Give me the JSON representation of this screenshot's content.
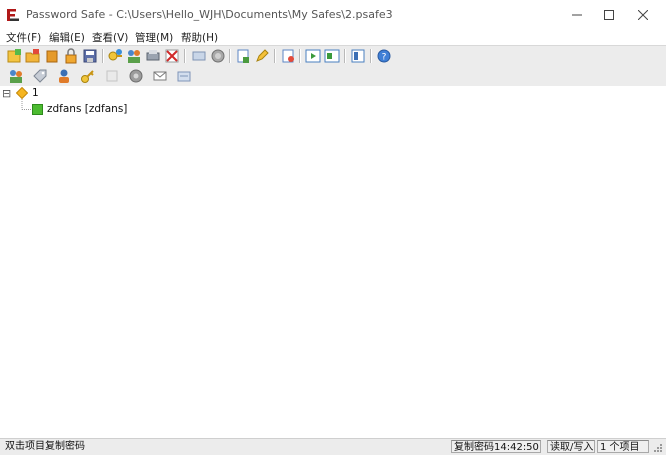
{
  "window": {
    "title": "Password Safe - C:\\Users\\Hello_WJH\\Documents\\My Safes\\2.psafe3",
    "app_icon": "password-safe-logo",
    "controls": [
      "minimize-icon",
      "maximize-icon",
      "close-icon"
    ]
  },
  "menu": [
    "文件(F)",
    "编辑(E)",
    "查看(V)",
    "管理(M)",
    "帮助(H)"
  ],
  "toolbar1": [
    "new-database-icon",
    "open-database-icon",
    "close-database-icon",
    "lock-database-icon",
    "save-icon",
    "add-entry-icon",
    "add-group-icon",
    "view-entry-icon",
    "delete-entry-icon",
    "copy-password-icon",
    "browse-url-icon",
    "export-icon",
    "edit-icon",
    "find-icon",
    "expand-all-icon",
    "collapse-all-icon",
    "options-icon",
    "help-icon"
  ],
  "toolbar2": [
    "add-shortcut-icon",
    "tag-icon",
    "user-icon",
    "key-icon",
    "notes-icon",
    "run-command-icon",
    "email-icon",
    "autotype-icon"
  ],
  "tree": {
    "group": {
      "expander": "⊟",
      "label": "1"
    },
    "entry": {
      "label": "zdfans [zdfans]"
    }
  },
  "status": {
    "hint": "双击项目复制密码",
    "clipboard": "复制密码14:42:50",
    "mode": "读取/写入",
    "count": "1 个项目"
  }
}
